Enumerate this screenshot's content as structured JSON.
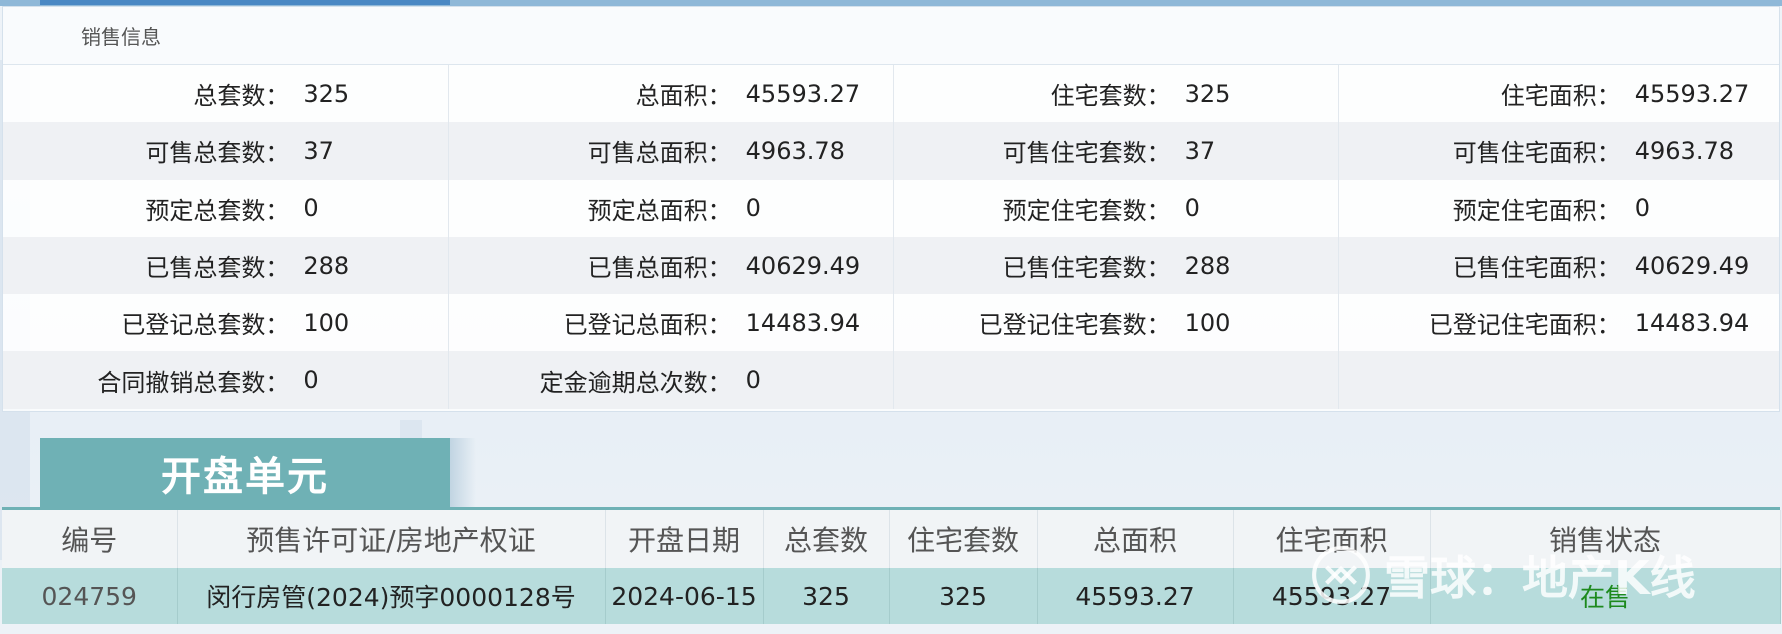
{
  "sales_info": {
    "header": "销售信息",
    "rows": [
      [
        {
          "label": "总套数：",
          "value": "325"
        },
        {
          "label": "总面积：",
          "value": "45593.27"
        },
        {
          "label": "住宅套数：",
          "value": "325"
        },
        {
          "label": "住宅面积：",
          "value": "45593.27"
        }
      ],
      [
        {
          "label": "可售总套数：",
          "value": "37"
        },
        {
          "label": "可售总面积：",
          "value": "4963.78"
        },
        {
          "label": "可售住宅套数：",
          "value": "37"
        },
        {
          "label": "可售住宅面积：",
          "value": "4963.78"
        }
      ],
      [
        {
          "label": "预定总套数：",
          "value": "0"
        },
        {
          "label": "预定总面积：",
          "value": "0"
        },
        {
          "label": "预定住宅套数：",
          "value": "0"
        },
        {
          "label": "预定住宅面积：",
          "value": "0"
        }
      ],
      [
        {
          "label": "已售总套数：",
          "value": "288"
        },
        {
          "label": "已售总面积：",
          "value": "40629.49"
        },
        {
          "label": "已售住宅套数：",
          "value": "288"
        },
        {
          "label": "已售住宅面积：",
          "value": "40629.49"
        }
      ],
      [
        {
          "label": "已登记总套数：",
          "value": "100"
        },
        {
          "label": "已登记总面积：",
          "value": "14483.94"
        },
        {
          "label": "已登记住宅套数：",
          "value": "100"
        },
        {
          "label": "已登记住宅面积：",
          "value": "14483.94"
        }
      ],
      [
        {
          "label": "合同撤销总套数：",
          "value": "0"
        },
        {
          "label": "定金逾期总次数：",
          "value": "0"
        },
        {
          "label": "",
          "value": ""
        },
        {
          "label": "",
          "value": ""
        }
      ]
    ]
  },
  "opening_units": {
    "tab_title": "开盘单元",
    "columns": [
      "编号",
      "预售许可证/房地产权证",
      "开盘日期",
      "总套数",
      "住宅套数",
      "总面积",
      "住宅面积",
      "销售状态"
    ],
    "rows": [
      {
        "id": "024759",
        "permit": "闵行房管(2024)预字0000128号",
        "open_date": "2024-06-15",
        "total_units": "325",
        "residential_units": "325",
        "total_area": "45593.27",
        "residential_area": "45593.27",
        "status": "在售"
      }
    ]
  },
  "watermark": {
    "text": "雪球：地产K线",
    "icon": "snowball-logo-icon"
  },
  "colors": {
    "tab_teal": "#6fb1b5",
    "row_teal": "#b7dcdc",
    "status_green": "#1d8a1d",
    "top_accent": "#4a88c4"
  }
}
